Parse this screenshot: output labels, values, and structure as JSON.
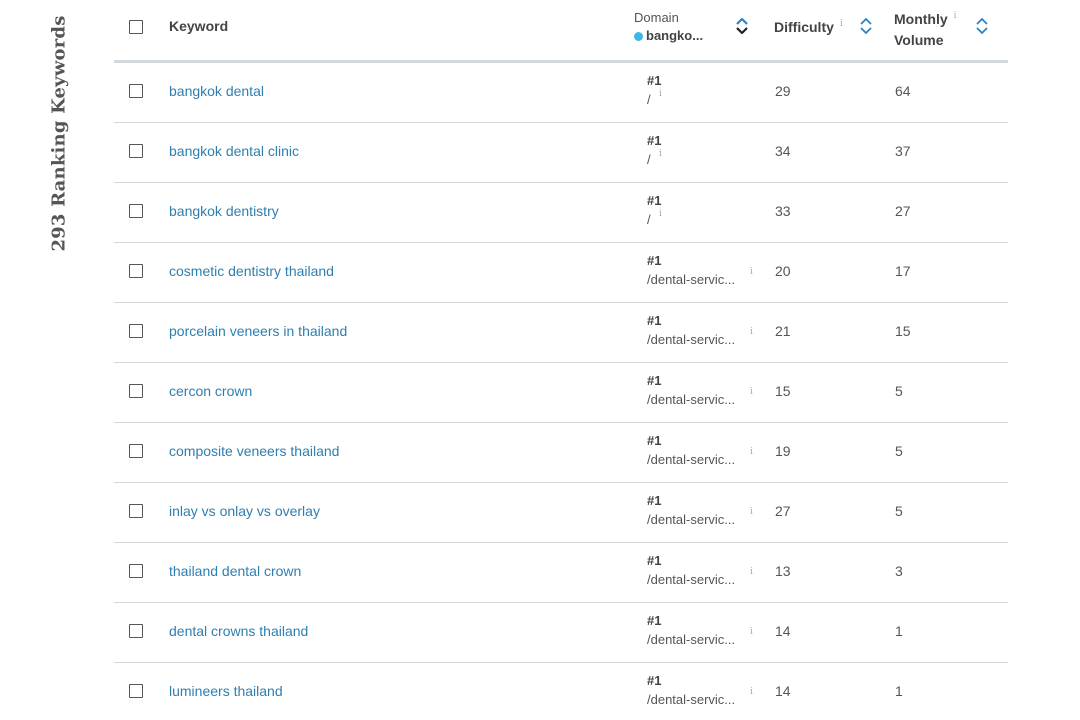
{
  "sidebar": {
    "title": "293 Ranking Keywords"
  },
  "header": {
    "keyword": "Keyword",
    "domain_label": "Domain",
    "domain_name": "bangko...",
    "difficulty": "Difficulty",
    "volume_line1": "Monthly",
    "volume_line2": "Volume",
    "info_glyph": "i"
  },
  "colors": {
    "link": "#2e7fb0",
    "sort_icon": "#2b84c2",
    "domain_dot": "#3db7e4"
  },
  "rows": [
    {
      "keyword": "bangkok dental",
      "rank": "#1",
      "url": "/",
      "difficulty": "29",
      "volume": "64"
    },
    {
      "keyword": "bangkok dental clinic",
      "rank": "#1",
      "url": "/",
      "difficulty": "34",
      "volume": "37"
    },
    {
      "keyword": "bangkok dentistry",
      "rank": "#1",
      "url": "/",
      "difficulty": "33",
      "volume": "27"
    },
    {
      "keyword": "cosmetic dentistry thailand",
      "rank": "#1",
      "url": "/dental-servic...",
      "difficulty": "20",
      "volume": "17"
    },
    {
      "keyword": "porcelain veneers in thailand",
      "rank": "#1",
      "url": "/dental-servic...",
      "difficulty": "21",
      "volume": "15"
    },
    {
      "keyword": "cercon crown",
      "rank": "#1",
      "url": "/dental-servic...",
      "difficulty": "15",
      "volume": "5"
    },
    {
      "keyword": "composite veneers thailand",
      "rank": "#1",
      "url": "/dental-servic...",
      "difficulty": "19",
      "volume": "5"
    },
    {
      "keyword": "inlay vs onlay vs overlay",
      "rank": "#1",
      "url": "/dental-servic...",
      "difficulty": "27",
      "volume": "5"
    },
    {
      "keyword": "thailand dental crown",
      "rank": "#1",
      "url": "/dental-servic...",
      "difficulty": "13",
      "volume": "3"
    },
    {
      "keyword": "dental crowns thailand",
      "rank": "#1",
      "url": "/dental-servic...",
      "difficulty": "14",
      "volume": "1"
    },
    {
      "keyword": "lumineers thailand",
      "rank": "#1",
      "url": "/dental-servic...",
      "difficulty": "14",
      "volume": "1"
    }
  ]
}
